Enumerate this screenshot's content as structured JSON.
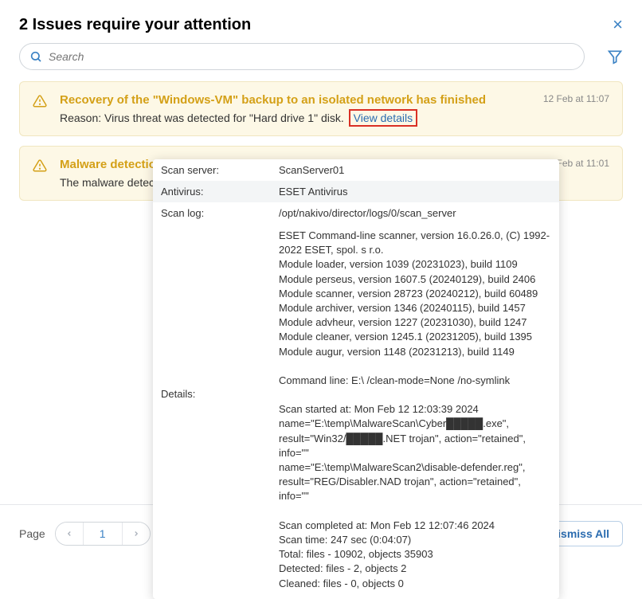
{
  "header": {
    "title": "2 Issues require your attention",
    "close_label": "×"
  },
  "search": {
    "placeholder": "Search"
  },
  "issues": [
    {
      "title": "Recovery of the \"Windows-VM\" backup to an isolated network has finished",
      "desc": "Reason: Virus threat was detected for \"Hard drive 1\" disk.",
      "link": "View details",
      "time": "12 Feb at 11:07"
    },
    {
      "title": "Malware detectio",
      "desc": "The malware detecti",
      "time": "Feb at 11:01"
    }
  ],
  "popover": {
    "rows": [
      {
        "label": "Scan server:",
        "value": "ScanServer01"
      },
      {
        "label": "Antivirus:",
        "value": "ESET Antivirus"
      },
      {
        "label": "Scan log:",
        "value": "/opt/nakivo/director/logs/0/scan_server"
      }
    ],
    "details_label": "Details:",
    "details_value": "ESET Command-line scanner, version 16.0.26.0, (C) 1992-2022 ESET, spol. s r.o.\nModule loader, version 1039 (20231023), build 1109\nModule perseus, version 1607.5 (20240129), build 2406\nModule scanner, version 28723 (20240212), build 60489\nModule archiver, version 1346 (20240115), build 1457\nModule advheur, version 1227 (20231030), build 1247\nModule cleaner, version 1245.1 (20231205), build 1395\nModule augur, version 1148 (20231213), build 1149\n\nCommand line: E:\\ /clean-mode=None /no-symlink\n\nScan started at: Mon Feb 12 12:03:39 2024\nname=\"E:\\temp\\MalwareScan\\Cyber█████.exe\", result=\"Win32/█████.NET trojan\", action=\"retained\", info=\"\"\nname=\"E:\\temp\\MalwareScan2\\disable-defender.reg\", result=\"REG/Disabler.NAD trojan\", action=\"retained\", info=\"\"\n\nScan completed at: Mon Feb 12 12:07:46 2024\nScan time: 247 sec (0:04:07)\nTotal: files - 10902, objects 35903\nDetected: files - 2, objects 2\nCleaned: files - 0, objects 0"
  },
  "footer": {
    "page_label": "Page",
    "page_num": "1",
    "dismiss": "Dismiss All"
  }
}
